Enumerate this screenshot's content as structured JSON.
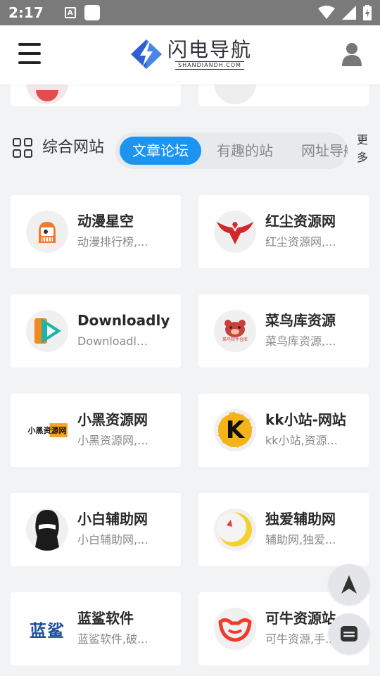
{
  "status_bar": {
    "time": "2:17",
    "a_icon": "A"
  },
  "header": {
    "logo_cn": "闪电导航",
    "logo_en": "SHANDIANDH.COM"
  },
  "category": {
    "title": "综合网站",
    "tabs": [
      {
        "label": "文章论坛",
        "active": true
      },
      {
        "label": "有趣的站",
        "active": false
      },
      {
        "label": "网址导航",
        "active": false
      }
    ],
    "more_label": "更多"
  },
  "cards": [
    {
      "name": "动漫星空",
      "desc": "动漫排行榜,...",
      "icon": "anime-star-icon"
    },
    {
      "name": "红尘资源网",
      "desc": "红尘资源网,...",
      "icon": "phoenix-icon"
    },
    {
      "name": "Downloadly",
      "desc": "Downloadly,...",
      "icon": "downloadly-play-icon"
    },
    {
      "name": "菜鸟库资源",
      "desc": "菜鸟库资源,...",
      "icon": "bear-icon",
      "icon_text": "菜鸟软件仓库"
    },
    {
      "name": "小黑资源网",
      "desc": "小黑资源网,Q...",
      "icon": "xiaohei-logo-icon",
      "icon_text": "小黑资源网"
    },
    {
      "name": "kk小站-网站",
      "desc": "kk小站,资源...",
      "icon": "kk-logo-icon",
      "icon_text": "K"
    },
    {
      "name": "小白辅助网",
      "desc": "小白辅助网,...",
      "icon": "masked-person-icon"
    },
    {
      "name": "独爱辅助网",
      "desc": "辅助网,独爱...",
      "icon": "crescent-icon"
    },
    {
      "name": "蓝鲨软件",
      "desc": "蓝鲨软件,破...",
      "icon": "lansha-logo-icon",
      "icon_text": "蓝鲨"
    },
    {
      "name": "可牛资源站",
      "desc": "可牛资源,手...",
      "icon": "keniu-bowl-icon"
    }
  ],
  "fabs": {
    "top": "navigation-arrow-icon",
    "chat": "chat-icon"
  },
  "colors": {
    "accent": "#1b95f0",
    "logo_blue": "#2f5fd0",
    "status_bar": "#7a7a7a"
  }
}
